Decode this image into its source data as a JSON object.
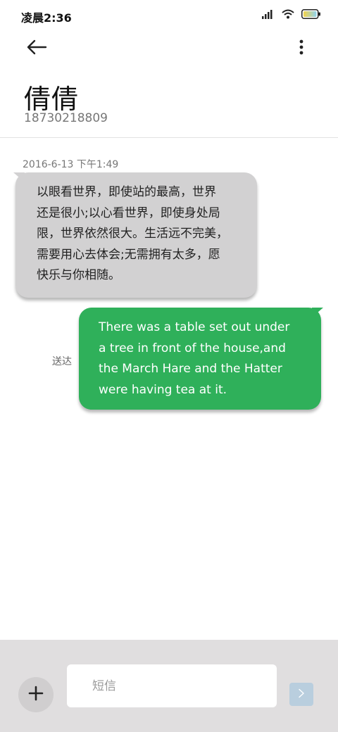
{
  "status_bar": {
    "time": "凌晨2:36",
    "icons": [
      "signal-icon",
      "wifi-icon",
      "battery-icon"
    ]
  },
  "toolbar": {
    "back_icon": "back-arrow-icon",
    "more_icon": "more-vertical-icon"
  },
  "contact": {
    "name": "倩倩",
    "number": "18730218809"
  },
  "conversation": {
    "timestamp": "2016-6-13 下午1:49",
    "messages": [
      {
        "direction": "incoming",
        "lines": [
          "以眼看世界，即使站的最高，世界",
          "还是很小;以心看世界，即使身处局",
          "限，世界依然很大。生活远不完美，",
          "需要用心去体会;无需拥有太多，愿",
          "快乐与你相随。"
        ]
      },
      {
        "direction": "outgoing",
        "lines": [
          "There was a table set out under",
          "a tree in front of the house,and",
          "the March Hare and the Hatter",
          "were having tea at it."
        ],
        "status": "送达"
      }
    ]
  },
  "composer": {
    "add_icon": "plus-icon",
    "placeholder": "短信",
    "value": "",
    "send_icon": "send-chevron-icon"
  },
  "colors": {
    "incoming_bubble": "#d2d1d2",
    "outgoing_bubble": "#2fb05a",
    "composer_bar": "#e0dedf",
    "send_button": "#b9cede"
  }
}
